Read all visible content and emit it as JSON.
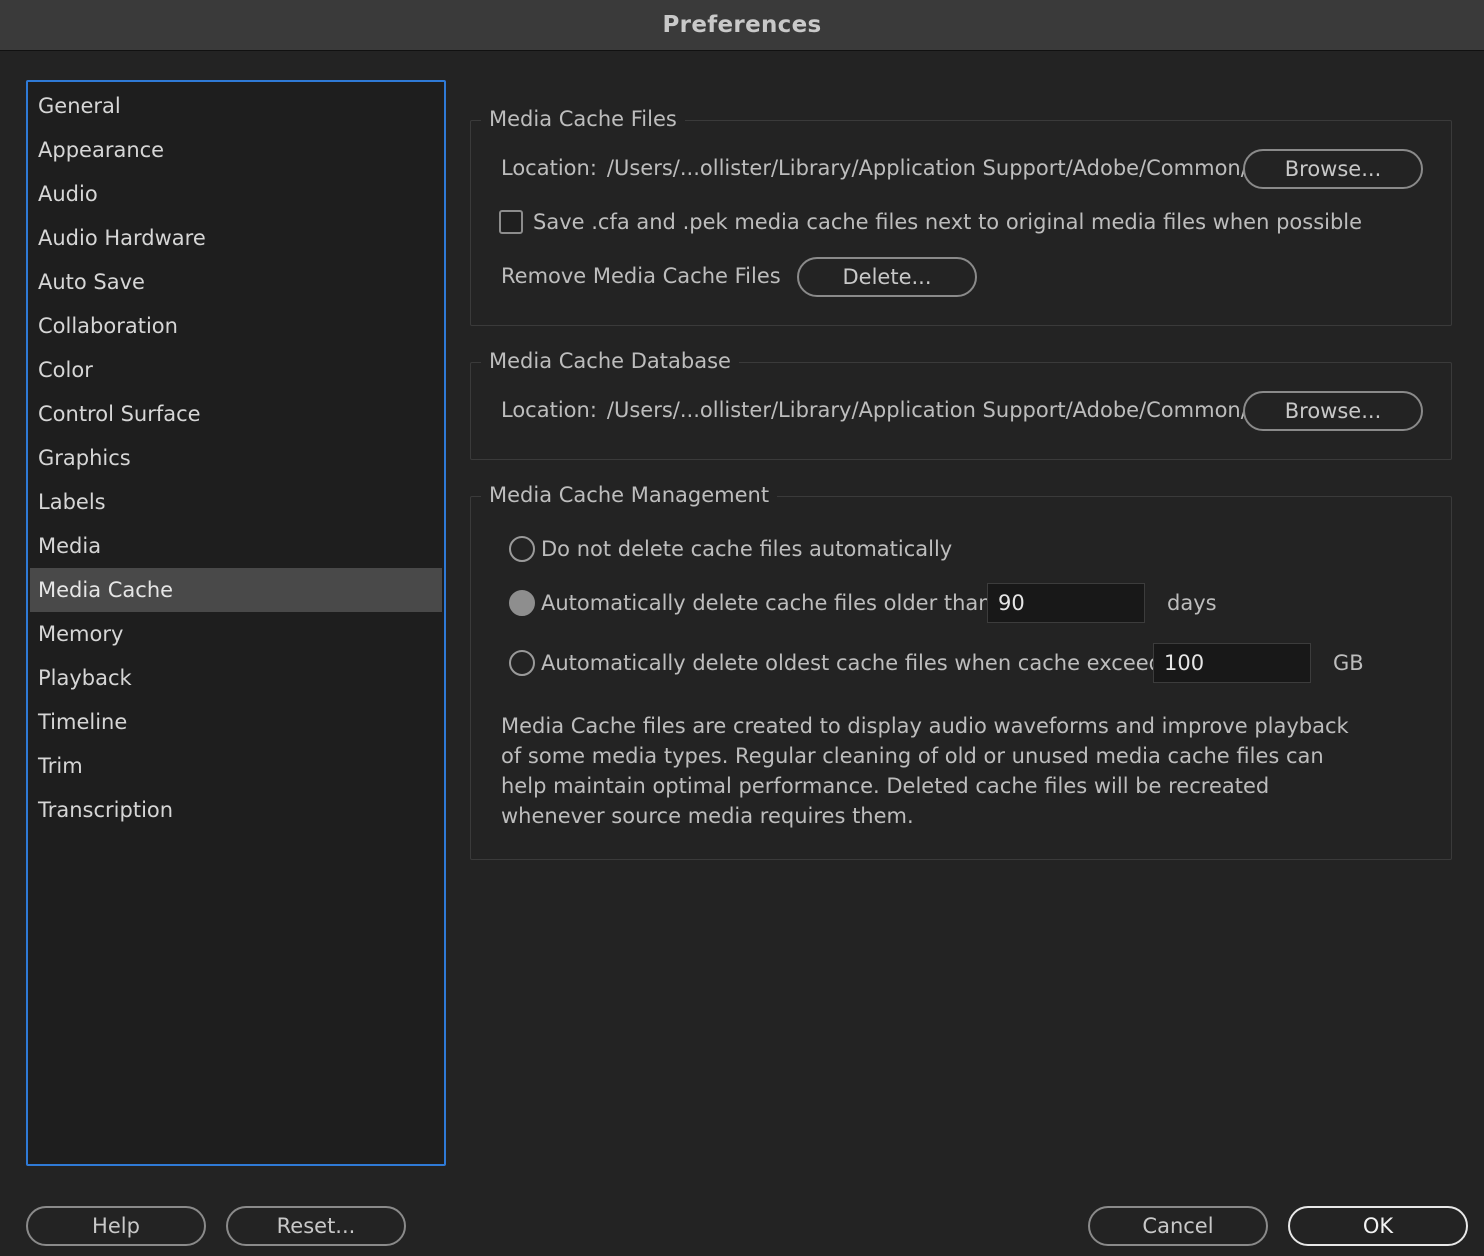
{
  "window": {
    "title": "Preferences"
  },
  "sidebar": {
    "items": [
      {
        "label": "General"
      },
      {
        "label": "Appearance"
      },
      {
        "label": "Audio"
      },
      {
        "label": "Audio Hardware"
      },
      {
        "label": "Auto Save"
      },
      {
        "label": "Collaboration"
      },
      {
        "label": "Color"
      },
      {
        "label": "Control Surface"
      },
      {
        "label": "Graphics"
      },
      {
        "label": "Labels"
      },
      {
        "label": "Media"
      },
      {
        "label": "Media Cache",
        "selected": true
      },
      {
        "label": "Memory"
      },
      {
        "label": "Playback"
      },
      {
        "label": "Timeline"
      },
      {
        "label": "Trim"
      },
      {
        "label": "Transcription"
      }
    ]
  },
  "media_cache_files": {
    "legend": "Media Cache Files",
    "location_label": "Location:",
    "location_path": "/Users/...ollister/Library/Application Support/Adobe/Common/",
    "browse_label": "Browse...",
    "save_next_to_media_label": "Save .cfa and .pek media cache files next to original media files when possible",
    "save_next_to_media_checked": false,
    "remove_label": "Remove Media Cache Files",
    "delete_label": "Delete..."
  },
  "media_cache_database": {
    "legend": "Media Cache Database",
    "location_label": "Location:",
    "location_path": "/Users/...ollister/Library/Application Support/Adobe/Common/",
    "browse_label": "Browse..."
  },
  "media_cache_management": {
    "legend": "Media Cache Management",
    "option_none_label": "Do not delete cache files automatically",
    "option_age_label": "Automatically delete cache files older than:",
    "age_value": "90",
    "age_unit": "days",
    "option_size_label": "Automatically delete oldest cache files when cache exceeds:",
    "size_value": "100",
    "size_unit": "GB",
    "selected_option": "age",
    "description": "Media Cache files are created to display audio waveforms and improve playback of some media types.  Regular cleaning of old or unused media cache files can help maintain optimal performance. Deleted cache files will be recreated whenever source media requires them."
  },
  "footer": {
    "help_label": "Help",
    "reset_label": "Reset...",
    "cancel_label": "Cancel",
    "ok_label": "OK"
  },
  "colors": {
    "accent": "#2f7ad6",
    "background": "#232323",
    "sidebar_selected": "#494949"
  }
}
